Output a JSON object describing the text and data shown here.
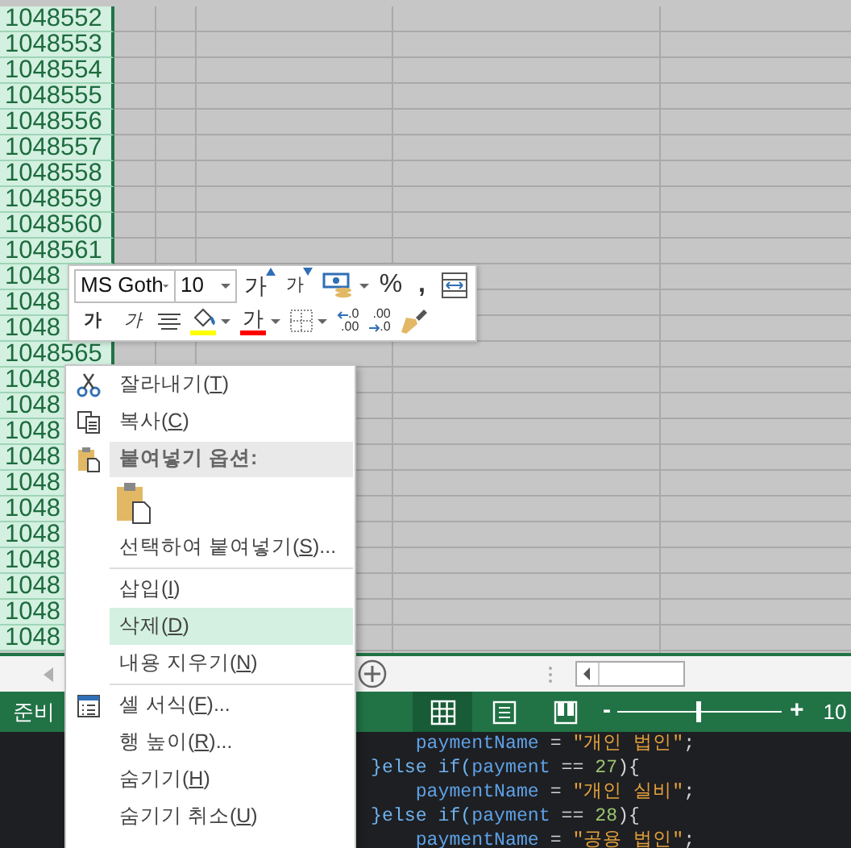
{
  "sheet": {
    "rows": [
      {
        "header": "1048552",
        "selected": true
      },
      {
        "header": "1048553",
        "selected": true
      },
      {
        "header": "1048554",
        "selected": true
      },
      {
        "header": "1048555",
        "selected": true
      },
      {
        "header": "1048556",
        "selected": true
      },
      {
        "header": "1048557",
        "selected": true
      },
      {
        "header": "1048558",
        "selected": true
      },
      {
        "header": "1048559",
        "selected": true
      },
      {
        "header": "1048560",
        "selected": true
      },
      {
        "header": "1048561",
        "selected": true
      },
      {
        "header": "1048",
        "selected": true
      },
      {
        "header": "1048",
        "selected": true
      },
      {
        "header": "1048",
        "selected": true
      },
      {
        "header": "1048565",
        "selected": true
      },
      {
        "header": "1048",
        "selected": true
      },
      {
        "header": "1048",
        "selected": true
      },
      {
        "header": "1048",
        "selected": true
      },
      {
        "header": "1048",
        "selected": true
      },
      {
        "header": "1048",
        "selected": true
      },
      {
        "header": "1048",
        "selected": true
      },
      {
        "header": "1048",
        "selected": true
      },
      {
        "header": "1048",
        "selected": true
      },
      {
        "header": "1048",
        "selected": true
      },
      {
        "header": "1048",
        "selected": true
      },
      {
        "header": "1048",
        "selected": true
      }
    ]
  },
  "mini_toolbar": {
    "font_name": "MS Goth",
    "font_size": "10",
    "grow_font": "가",
    "shrink_font": "가",
    "percent": "%",
    "comma": ",",
    "bold": "가",
    "italic": "가",
    "font_color": "가",
    "increase_decimal": {
      "top": ".0",
      "bottom": ".00"
    },
    "decrease_decimal": {
      "top": ".00",
      "bottom": ".0"
    }
  },
  "context_menu": {
    "groups": [
      [
        {
          "kind": "command",
          "label": "잘라내기(T)",
          "selected": false
        },
        {
          "kind": "command",
          "label": "복사(C)",
          "selected": false
        },
        {
          "kind": "header",
          "label": "붙여넣기 옵션:"
        },
        {
          "kind": "paste-option"
        },
        {
          "kind": "command",
          "label": "선택하여 붙여넣기(S)...",
          "selected": false
        }
      ],
      [
        {
          "kind": "command",
          "label": "삽입(I)",
          "selected": false
        },
        {
          "kind": "command",
          "label": "삭제(D)",
          "selected": true
        },
        {
          "kind": "command",
          "label": "내용 지우기(N)",
          "selected": false
        }
      ],
      [
        {
          "kind": "command",
          "label": "셀 서식(F)...",
          "selected": false
        },
        {
          "kind": "command",
          "label": "행 높이(R)...",
          "selected": false
        },
        {
          "kind": "command",
          "label": "숨기기(H)",
          "selected": false
        },
        {
          "kind": "command",
          "label": "숨기기 취소(U)",
          "selected": false
        }
      ]
    ]
  },
  "status_bar": {
    "status": "준비",
    "views": [
      {
        "selected": true
      },
      {
        "selected": false
      },
      {
        "selected": false
      }
    ],
    "zoom": {
      "minus": "-",
      "plus": "+",
      "level": 0.49,
      "percent": "10"
    }
  },
  "code_lines": [
    [
      {
        "kind": "variable",
        "text": "    paymentName"
      },
      {
        "kind": "operator",
        "text": " = "
      },
      {
        "kind": "string",
        "text": "\"개인 법인\""
      },
      {
        "kind": "punct",
        "text": ";"
      }
    ],
    [
      {
        "kind": "keyword",
        "text": "}else if("
      },
      {
        "kind": "variable",
        "text": "payment"
      },
      {
        "kind": "operator",
        "text": " == "
      },
      {
        "kind": "number",
        "text": "27"
      },
      {
        "kind": "punct",
        "text": "){"
      }
    ],
    [
      {
        "kind": "variable",
        "text": "    paymentName"
      },
      {
        "kind": "operator",
        "text": " = "
      },
      {
        "kind": "string",
        "text": "\"개인 실비\""
      },
      {
        "kind": "punct",
        "text": ";"
      }
    ],
    [
      {
        "kind": "keyword",
        "text": "}else if("
      },
      {
        "kind": "variable",
        "text": "payment"
      },
      {
        "kind": "operator",
        "text": " == "
      },
      {
        "kind": "number",
        "text": "28"
      },
      {
        "kind": "punct",
        "text": "){"
      }
    ],
    [
      {
        "kind": "variable",
        "text": "    paymentName"
      },
      {
        "kind": "operator",
        "text": " = "
      },
      {
        "kind": "string",
        "text": "\"공용 법인\""
      },
      {
        "kind": "punct",
        "text": ";"
      }
    ]
  ]
}
